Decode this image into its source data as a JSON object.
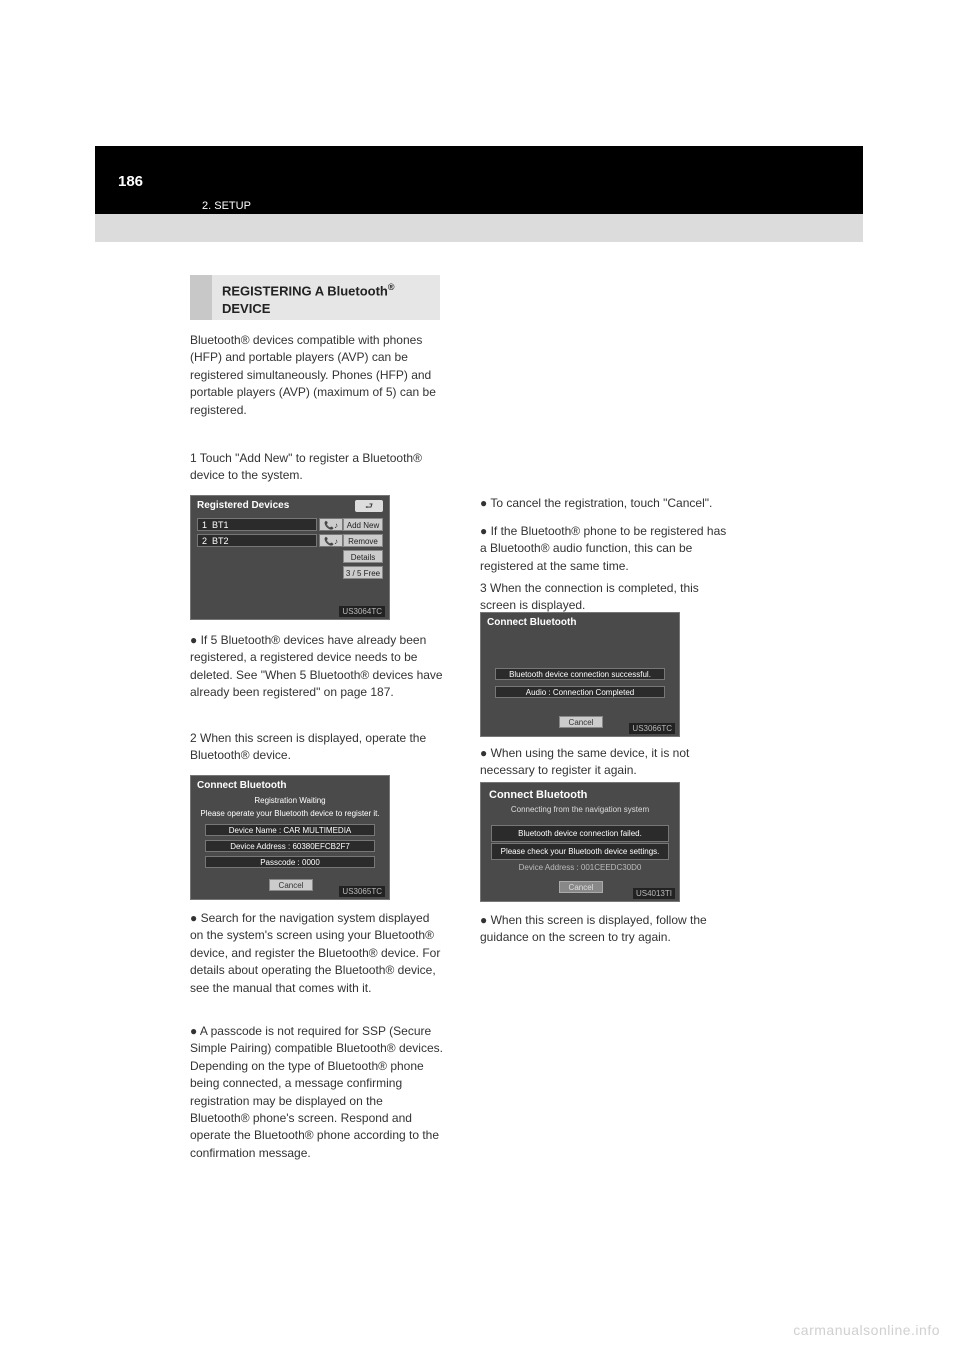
{
  "page_number": "186",
  "breadcrumb": "2. SETUP",
  "section_heading": {
    "prefix": "REGISTERING A Bluetooth",
    "superscript": "®",
    "suffix": "DEVICE"
  },
  "left_column": {
    "intro_para": "Bluetooth® devices compatible with phones (HFP) and portable players (AVP) can be registered simultaneously. Phones (HFP) and portable players (AVP) (maximum of 5) can be registered.",
    "step1": "1  Touch \"Add New\" to register a Bluetooth® device to the system.",
    "note1": "● If 5 Bluetooth® devices have already been registered, a registered device needs to be deleted. See \"When 5 Bluetooth® devices have already been registered\" on page 187.",
    "step2": "2  When this screen is displayed, operate the Bluetooth® device.",
    "note2": "● Search for the navigation system displayed on the system's screen using your Bluetooth® device, and register the Bluetooth® device. For details about operating the Bluetooth® device, see the manual that comes with it.",
    "note3": "● A passcode is not required for SSP (Secure Simple Pairing) compatible Bluetooth® devices. Depending on the type of Bluetooth® phone being connected, a message confirming registration may be displayed on the Bluetooth® phone's screen. Respond and operate the Bluetooth® phone according to the confirmation message."
  },
  "right_column": {
    "note4": "● To cancel the registration, touch \"Cancel\".",
    "note5": "● If the Bluetooth® phone to be registered has a Bluetooth® audio function, this can be registered at the same time.",
    "step3": "3  When the connection is completed, this screen is displayed.",
    "note6": "● When using the same device, it is not necessary to register it again.",
    "note7": "● When this screen is displayed, follow the guidance on the screen to try again."
  },
  "fig1": {
    "title": "Registered Devices",
    "rows": [
      {
        "slot": "1",
        "name": "BT1"
      },
      {
        "slot": "2",
        "name": "BT2"
      }
    ],
    "icons": "📞♪",
    "buttons": {
      "add": "Add New",
      "remove": "Remove",
      "details": "Details",
      "free": "3 / 5  Free"
    },
    "back": "⮐",
    "caption": "US3064TC"
  },
  "fig2": {
    "title": "Connect Bluetooth",
    "subtitle": "Registration Waiting",
    "instruction": "Please operate your Bluetooth device to register it.",
    "device_name_label": "Device Name : CAR MULTIMEDIA",
    "device_addr_label": "Device Address : 60380EFCB2F7",
    "passcode_label": "Passcode : 0000",
    "cancel": "Cancel",
    "caption": "US3065TC"
  },
  "fig3": {
    "title": "Connect Bluetooth",
    "msg1": "Bluetooth device connection successful.",
    "msg2": "Audio : Connection Completed",
    "cancel": "Cancel",
    "caption": "US3066TC"
  },
  "fig4": {
    "title": "Connect Bluetooth",
    "subtitle": "Connecting from the navigation system",
    "msg1": "Bluetooth device connection failed.",
    "msg2": "Please check your Bluetooth device settings.",
    "addr": "Device Address : 001CEEDC30D0",
    "cancel": "Cancel",
    "caption": "US4013TI"
  },
  "watermark": "carmanualsonline.info"
}
